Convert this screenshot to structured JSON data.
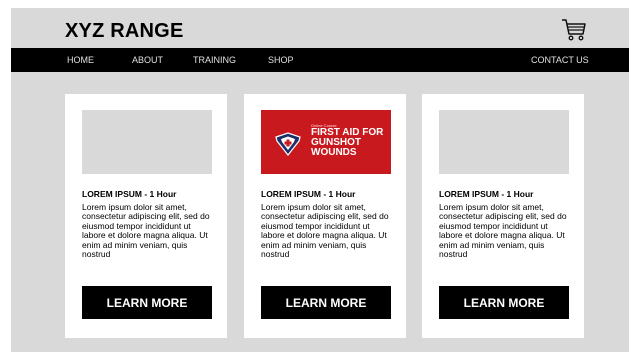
{
  "header": {
    "brand": "XYZ RANGE",
    "cart_icon": "shopping-cart-icon"
  },
  "nav": {
    "home": "HOME",
    "about": "ABOUT",
    "training": "TRAINING",
    "shop": "SHOP",
    "contact": "CONTACT US"
  },
  "cards": [
    {
      "title": "LOREM IPSUM - 1 Hour",
      "text": "Lorem ipsum dolor sit amet, consectetur adipiscing elit, sed do eiusmod tempor incididunt ut labore et dolore magna aliqua. Ut enim ad minim veniam, quis nostrud",
      "button": "LEARN MORE"
    },
    {
      "promo": {
        "small": "Online Course",
        "title": "FIRST AID FOR GUNSHOT WOUNDS",
        "icon": "medical-shield-icon"
      },
      "title": "LOREM IPSUM - 1 Hour",
      "text": "Lorem ipsum dolor sit amet, consectetur adipiscing elit, sed do eiusmod tempor incididunt ut labore et dolore magna aliqua. Ut enim ad minim veniam, quis nostrud",
      "button": "LEARN MORE"
    },
    {
      "title": "LOREM IPSUM - 1 Hour",
      "text": "Lorem ipsum dolor sit amet, consectetur adipiscing elit, sed do eiusmod tempor incididunt ut labore et dolore magna aliqua. Ut enim ad minim veniam, quis nostrud",
      "button": "LEARN MORE"
    }
  ],
  "colors": {
    "promo_red": "#c8191f",
    "nav_bg": "#000000",
    "page_bg": "#d9d9d9"
  }
}
